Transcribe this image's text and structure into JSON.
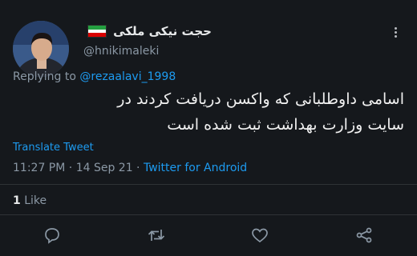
{
  "author": {
    "display_name": "حجت نیکی ملکی",
    "handle": "@hnikimaleki",
    "flag_icon": "iran-flag-icon",
    "flag_colors": [
      "#239f40",
      "#ffffff",
      "#da0000"
    ]
  },
  "reply": {
    "prefix": "Replying to",
    "mention": "@rezaalavi_1998"
  },
  "tweet": {
    "text_line_1": "اسامی داوطلبانی که واکسن دریافت کردند در",
    "text_line_2": "سایت وزارت بهداشت ثبت شده است"
  },
  "translate_label": "Translate Tweet",
  "meta": {
    "time": "11:27 PM",
    "sep1": " · ",
    "date": "14 Sep 21",
    "sep2": " · ",
    "source": "Twitter for Android"
  },
  "stats": {
    "likes_count": "1",
    "likes_label": "Like"
  },
  "actions": [
    "reply-icon",
    "retweet-icon",
    "like-icon",
    "share-icon"
  ],
  "colors": {
    "background": "#15181c",
    "accent": "#1d9bf0",
    "muted": "#8b98a5"
  }
}
